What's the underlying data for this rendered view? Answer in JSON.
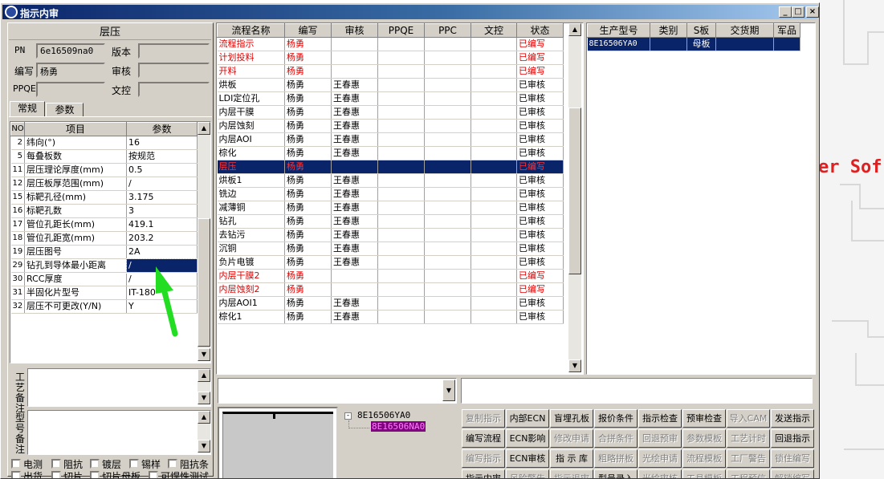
{
  "window": {
    "title": "指示内审"
  },
  "left": {
    "header": "层压",
    "pn_label": "PN",
    "pn_value": "6e16509na0",
    "version_label": "版本",
    "version_value": "",
    "author_label": "编写",
    "author_value": "杨勇",
    "review_label": "审核",
    "review_value": "",
    "ppqe_label": "PPQE",
    "ppqe_value": "",
    "doc_label": "文控",
    "doc_value": "",
    "tabs": [
      "常规",
      "参数"
    ],
    "param_headers": [
      "NO",
      "项目",
      "参数"
    ],
    "params": [
      {
        "no": "2",
        "item": "纬向(°)",
        "val": "16"
      },
      {
        "no": "5",
        "item": "每叠板数",
        "val": "按规范"
      },
      {
        "no": "11",
        "item": "层压理论厚度(mm)",
        "val": "0.5"
      },
      {
        "no": "12",
        "item": "层压板厚范围(mm)",
        "val": "/"
      },
      {
        "no": "15",
        "item": "标靶孔径(mm)",
        "val": "3.175"
      },
      {
        "no": "16",
        "item": "标靶孔数",
        "val": "3"
      },
      {
        "no": "17",
        "item": "管位孔距长(mm)",
        "val": "419.1"
      },
      {
        "no": "18",
        "item": "管位孔距宽(mm)",
        "val": "203.2"
      },
      {
        "no": "19",
        "item": "层压图号",
        "val": "2A"
      },
      {
        "no": "29",
        "item": "钻孔到导体最小距离",
        "val": "/"
      },
      {
        "no": "30",
        "item": "RCC厚度",
        "val": "/"
      },
      {
        "no": "31",
        "item": "半固化片型号",
        "val": "IT-180"
      },
      {
        "no": "32",
        "item": "层压不可更改(Y/N)",
        "val": "Y"
      }
    ],
    "craft_note_label": "工艺备注",
    "type_note_label": "型号备注",
    "checks_row1": [
      "电测",
      "阻抗",
      "镀层",
      "锡样",
      "阻抗条"
    ],
    "checks_row2": [
      "出货",
      "切片",
      "切片母板",
      "可焊性测试"
    ]
  },
  "flow": {
    "headers": [
      "流程名称",
      "编写",
      "审核",
      "PPQE",
      "PPC",
      "文控",
      "状态"
    ],
    "rows": [
      {
        "name": "流程指示",
        "author": "杨勇",
        "reviewer": "",
        "status": "已编写",
        "red": true
      },
      {
        "name": "计划投料",
        "author": "杨勇",
        "reviewer": "",
        "status": "已编写",
        "red": true
      },
      {
        "name": "开料",
        "author": "杨勇",
        "reviewer": "",
        "status": "已编写",
        "red": true
      },
      {
        "name": "烘板",
        "author": "杨勇",
        "reviewer": "王春惠",
        "status": "已审核",
        "red": false
      },
      {
        "name": "LDI定位孔",
        "author": "杨勇",
        "reviewer": "王春惠",
        "status": "已审核",
        "red": false
      },
      {
        "name": "内层干膜",
        "author": "杨勇",
        "reviewer": "王春惠",
        "status": "已审核",
        "red": false
      },
      {
        "name": "内层蚀刻",
        "author": "杨勇",
        "reviewer": "王春惠",
        "status": "已审核",
        "red": false
      },
      {
        "name": "内层AOI",
        "author": "杨勇",
        "reviewer": "王春惠",
        "status": "已审核",
        "red": false
      },
      {
        "name": "棕化",
        "author": "杨勇",
        "reviewer": "王春惠",
        "status": "已审核",
        "red": false
      },
      {
        "name": "层压",
        "author": "杨勇",
        "reviewer": "",
        "status": "已编写",
        "red": true,
        "selected": true
      },
      {
        "name": "烘板1",
        "author": "杨勇",
        "reviewer": "王春惠",
        "status": "已审核",
        "red": false
      },
      {
        "name": "铣边",
        "author": "杨勇",
        "reviewer": "王春惠",
        "status": "已审核",
        "red": false
      },
      {
        "name": "减薄铜",
        "author": "杨勇",
        "reviewer": "王春惠",
        "status": "已审核",
        "red": false
      },
      {
        "name": "钻孔",
        "author": "杨勇",
        "reviewer": "王春惠",
        "status": "已审核",
        "red": false
      },
      {
        "name": "去钻污",
        "author": "杨勇",
        "reviewer": "王春惠",
        "status": "已审核",
        "red": false
      },
      {
        "name": "沉铜",
        "author": "杨勇",
        "reviewer": "王春惠",
        "status": "已审核",
        "red": false
      },
      {
        "name": "负片电镀",
        "author": "杨勇",
        "reviewer": "王春惠",
        "status": "已审核",
        "red": false
      },
      {
        "name": "内层干膜2",
        "author": "杨勇",
        "reviewer": "",
        "status": "已编写",
        "red": true
      },
      {
        "name": "内层蚀刻2",
        "author": "杨勇",
        "reviewer": "",
        "status": "已编写",
        "red": true
      },
      {
        "name": "内层AOI1",
        "author": "杨勇",
        "reviewer": "王春惠",
        "status": "已审核",
        "red": false
      },
      {
        "name": "棕化1",
        "author": "杨勇",
        "reviewer": "王春惠",
        "status": "已审核",
        "red": false
      }
    ]
  },
  "prod": {
    "headers": [
      "生产型号",
      "类别",
      "S板",
      "交货期",
      "军品"
    ],
    "rows": [
      {
        "model": "8E16506YA0",
        "cat": "",
        "s": "母板",
        "date": "",
        "mil": ""
      }
    ]
  },
  "tree": {
    "root": "8E16506YA0",
    "child": "8E16506NA0"
  },
  "buttons": [
    [
      "复制指示",
      "内部ECN",
      "盲埋孔板",
      "报价条件",
      "指示检查",
      "预审检查",
      "导入CAM",
      "发送指示"
    ],
    [
      "编写流程",
      "ECN影响",
      "修改申请",
      "合拼条件",
      "回退预审",
      "参数模板",
      "工艺计时",
      "回退指示"
    ],
    [
      "编写指示",
      "ECN审核",
      "指 示 库",
      "粗略拼板",
      "光绘申请",
      "流程模板",
      "工厂警告",
      "锁住编写"
    ],
    [
      "指示内审",
      "风险警告",
      "指示退审",
      "型号录入",
      "光绘审核",
      "工具模板",
      "工程预信",
      "解锁编写"
    ]
  ],
  "disabled_buttons": [
    "复制指示",
    "修改申请",
    "合拼条件",
    "回退预审",
    "参数模板",
    "工艺计时",
    "编写指示",
    "粗略拼板",
    "光绘申请",
    "流程模板",
    "工厂警告",
    "锁住编写",
    "风险警告",
    "指示退审",
    "光绘审核",
    "工具模板",
    "工程预信",
    "解锁编写",
    "导入CAM"
  ],
  "background_text": "er Sof",
  "colors": {
    "title_start": "#0a246a",
    "selection": "#0a246a",
    "red_text": "#e00000",
    "arrow": "#22dd22",
    "tree_highlight": "#800080"
  }
}
